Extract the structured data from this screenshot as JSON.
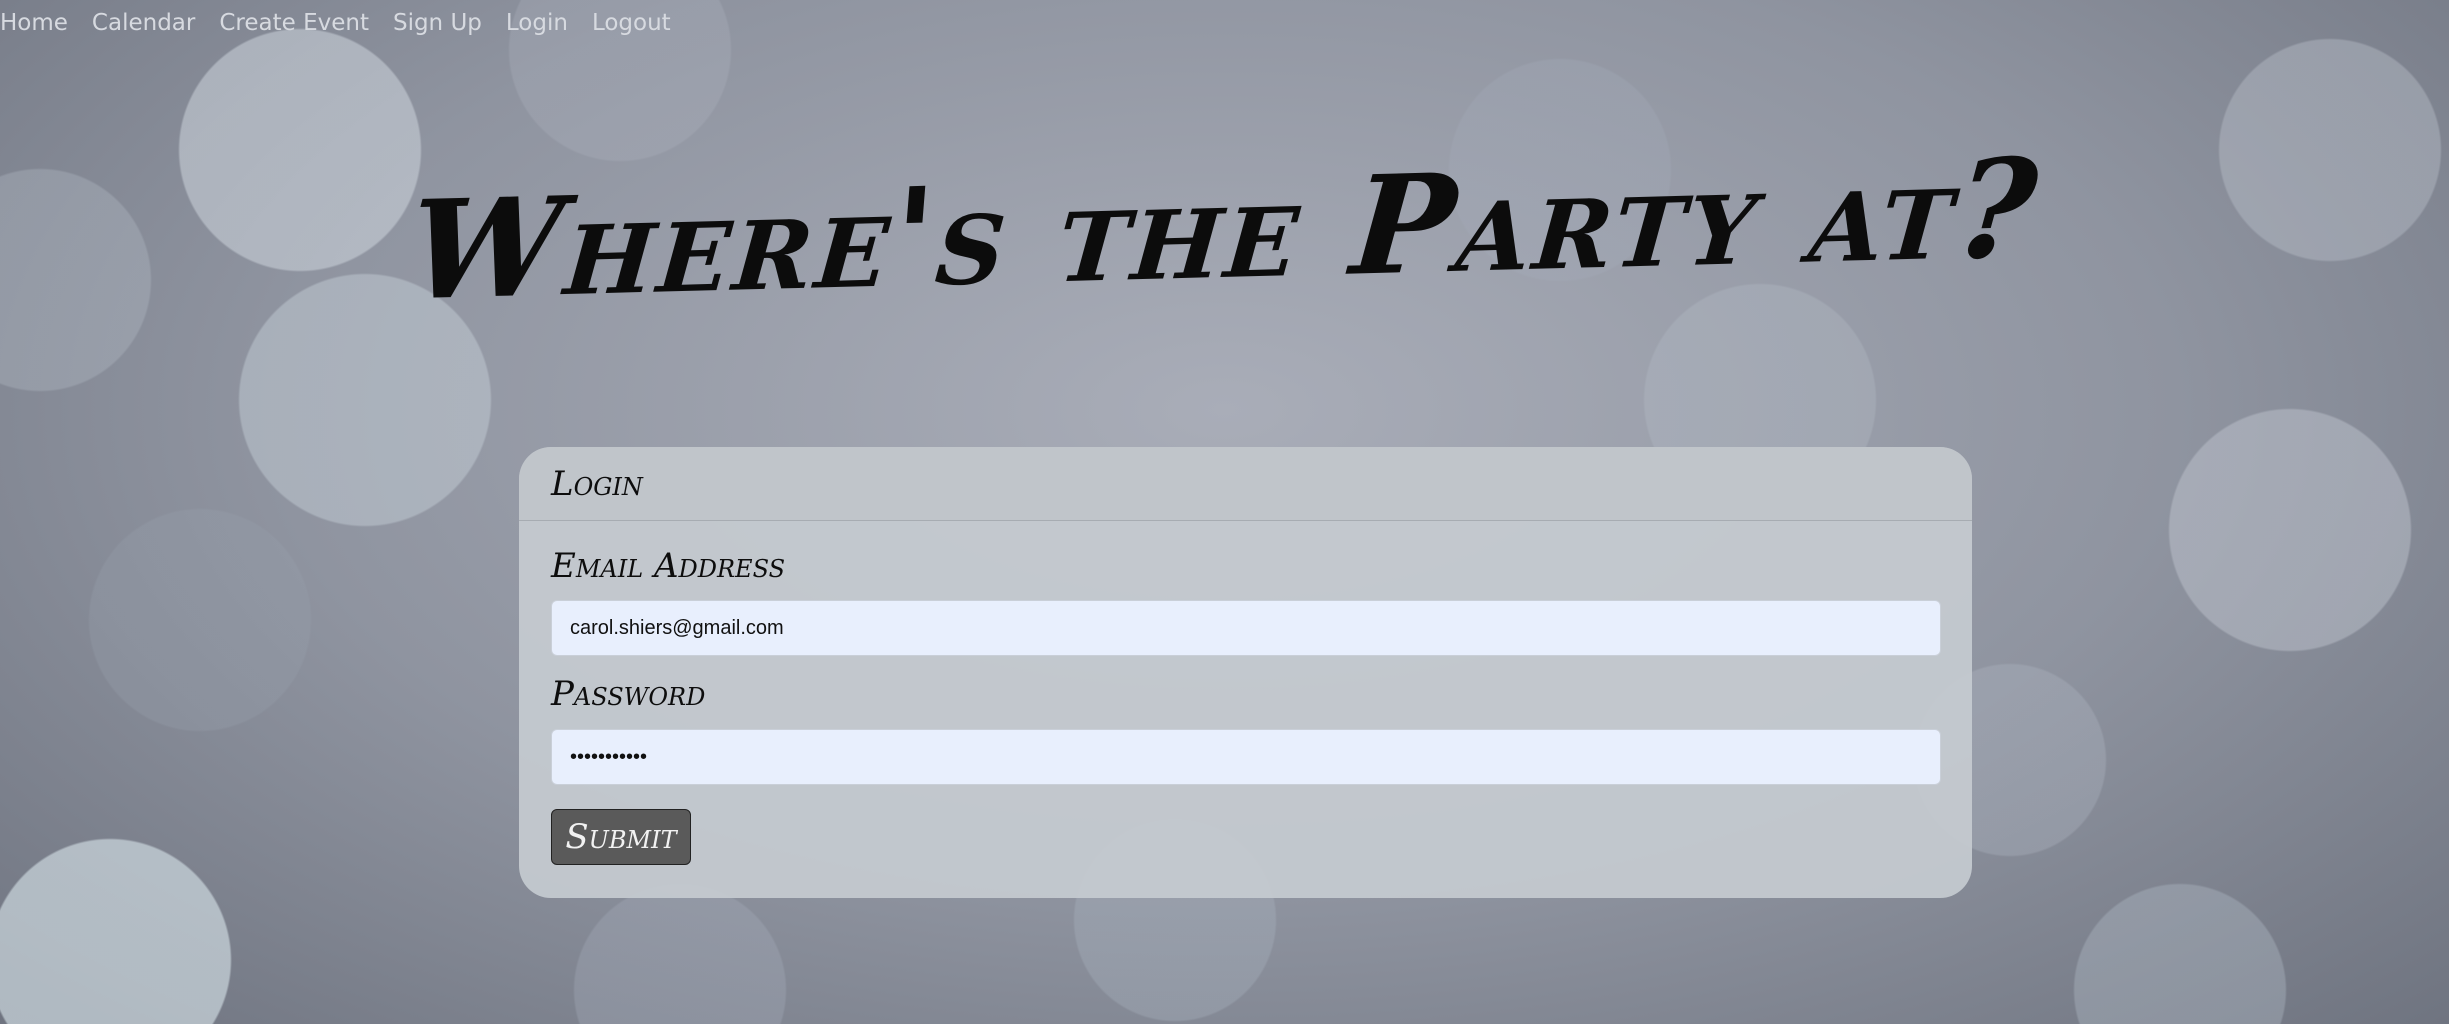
{
  "nav": {
    "items": [
      {
        "label": "Home"
      },
      {
        "label": "Calendar"
      },
      {
        "label": "Create Event"
      },
      {
        "label": "Sign Up"
      },
      {
        "label": "Login"
      },
      {
        "label": "Logout"
      }
    ]
  },
  "hero": {
    "title": "Where's the Party at?"
  },
  "login_card": {
    "header": "Login",
    "email_label": "Email Address",
    "email_value": "carol.shiers@gmail.com",
    "password_label": "Password",
    "password_value": "•••••••••••",
    "submit_label": "Submit"
  },
  "colors": {
    "card_bg": "#c6cbd0",
    "input_bg": "#e8effd",
    "button_bg": "#5a5a5a",
    "nav_text": "#d7dae0"
  }
}
